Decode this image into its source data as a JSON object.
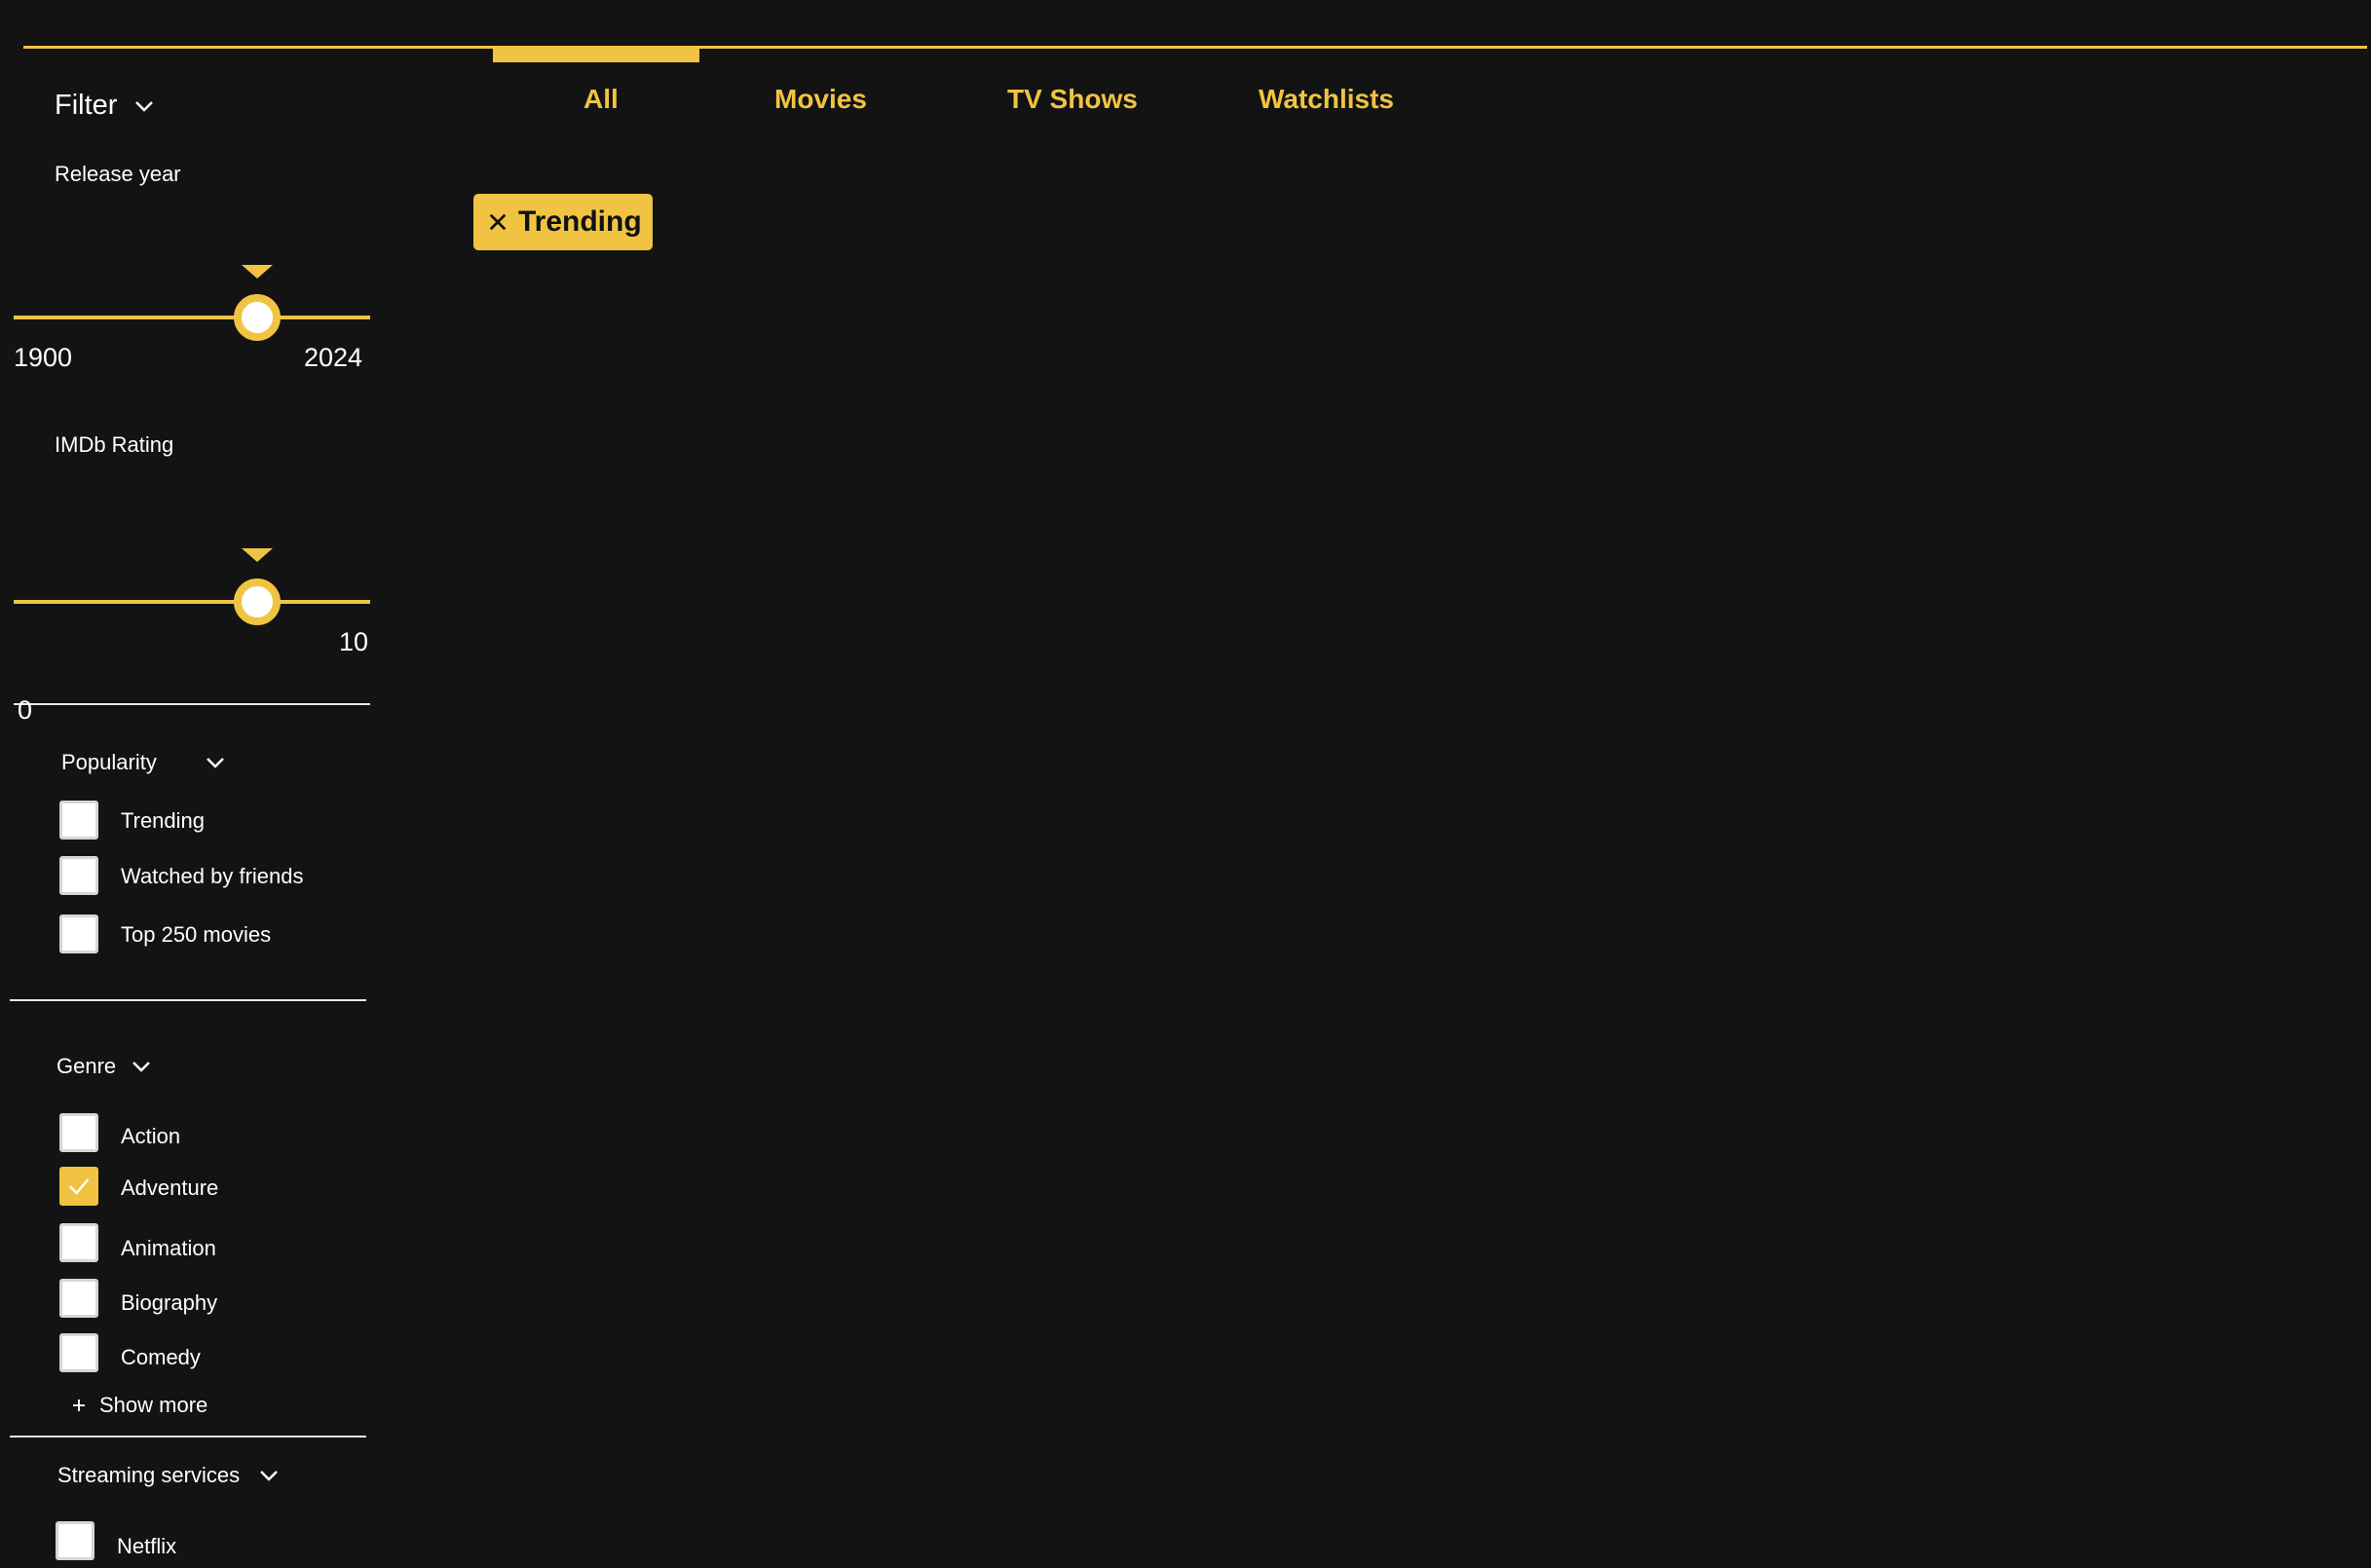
{
  "tabs": [
    {
      "label": "All",
      "active": true
    },
    {
      "label": "Movies",
      "active": false
    },
    {
      "label": "TV Shows",
      "active": false
    },
    {
      "label": "Watchlists",
      "active": false
    }
  ],
  "active_filter_chip": {
    "label": "Trending",
    "icon": "close-icon"
  },
  "sidebar": {
    "filter_label": "Filter",
    "release_year": {
      "label": "Release year",
      "min_label": "1900",
      "max_label": "2024",
      "value_fraction": 0.68
    },
    "imdb_rating": {
      "label": "IMDb Rating",
      "min_label": "0",
      "max_label": "10",
      "value_fraction": 0.68
    },
    "popularity": {
      "label": "Popularity",
      "items": [
        {
          "label": "Trending",
          "checked": false
        },
        {
          "label": "Watched by friends",
          "checked": false
        },
        {
          "label": "Top 250 movies",
          "checked": false
        }
      ]
    },
    "genre": {
      "label": "Genre",
      "items": [
        {
          "label": "Action",
          "checked": false
        },
        {
          "label": "Adventure",
          "checked": true
        },
        {
          "label": "Animation",
          "checked": false
        },
        {
          "label": "Biography",
          "checked": false
        },
        {
          "label": "Comedy",
          "checked": false
        }
      ],
      "show_more_label": "Show more"
    },
    "streaming": {
      "label": "Streaming services",
      "items": [
        {
          "label": "Netflix",
          "checked": false
        }
      ]
    }
  },
  "colors": {
    "accent": "#f0c442",
    "background": "#131313",
    "text": "#ffffff"
  }
}
